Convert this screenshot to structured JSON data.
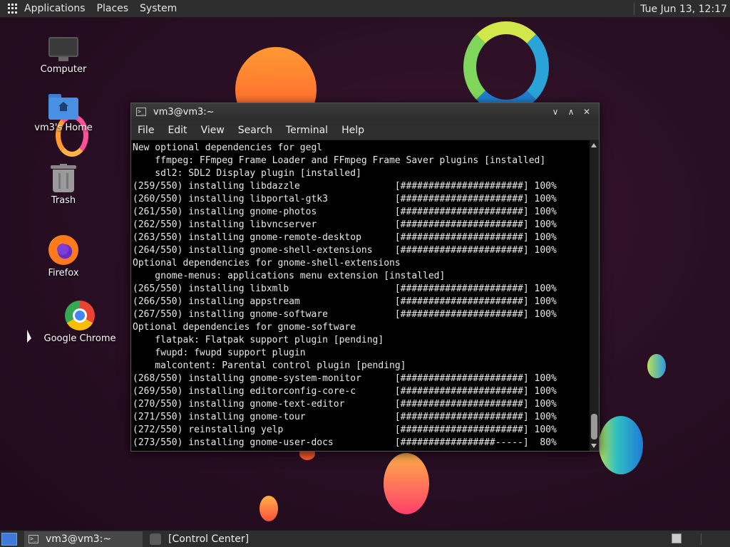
{
  "top_panel": {
    "menus": [
      "Applications",
      "Places",
      "System"
    ],
    "clock": "Tue Jun 13, 12:17"
  },
  "desktop_icons": [
    {
      "label": "Computer",
      "icon": "computer-icon"
    },
    {
      "label": "vm3's Home",
      "icon": "home-folder-icon"
    },
    {
      "label": "Trash",
      "icon": "trash-icon"
    },
    {
      "label": "Firefox",
      "icon": "firefox-icon"
    },
    {
      "label": "Google Chrome",
      "icon": "chrome-icon"
    }
  ],
  "terminal": {
    "title": "vm3@vm3:~",
    "window_buttons": {
      "minimize": "∨",
      "maximize": "∧",
      "close": "✕"
    },
    "menu": [
      "File",
      "Edit",
      "View",
      "Search",
      "Terminal",
      "Help"
    ],
    "lines": [
      "New optional dependencies for gegl",
      "    ffmpeg: FFmpeg Frame Loader and FFmpeg Frame Saver plugins [installed]",
      "    sdl2: SDL2 Display plugin [installed]",
      "(259/550) installing libdazzle                 [######################] 100%",
      "(260/550) installing libportal-gtk3            [######################] 100%",
      "(261/550) installing gnome-photos              [######################] 100%",
      "(262/550) installing libvncserver              [######################] 100%",
      "(263/550) installing gnome-remote-desktop      [######################] 100%",
      "(264/550) installing gnome-shell-extensions    [######################] 100%",
      "Optional dependencies for gnome-shell-extensions",
      "    gnome-menus: applications menu extension [installed]",
      "(265/550) installing libxmlb                   [######################] 100%",
      "(266/550) installing appstream                 [######################] 100%",
      "(267/550) installing gnome-software            [######################] 100%",
      "Optional dependencies for gnome-software",
      "    flatpak: Flatpak support plugin [pending]",
      "    fwupd: fwupd support plugin",
      "    malcontent: Parental control plugin [pending]",
      "(268/550) installing gnome-system-monitor      [######################] 100%",
      "(269/550) installing editorconfig-core-c       [######################] 100%",
      "(270/550) installing gnome-text-editor         [######################] 100%",
      "(271/550) installing gnome-tour                [######################] 100%",
      "(272/550) reinstalling yelp                    [######################] 100%",
      "(273/550) installing gnome-user-docs           [#################-----]  80%"
    ]
  },
  "taskbar": {
    "tasks": [
      {
        "label": "vm3@vm3:~",
        "active": true
      },
      {
        "label": "[Control Center]",
        "active": false
      }
    ]
  }
}
